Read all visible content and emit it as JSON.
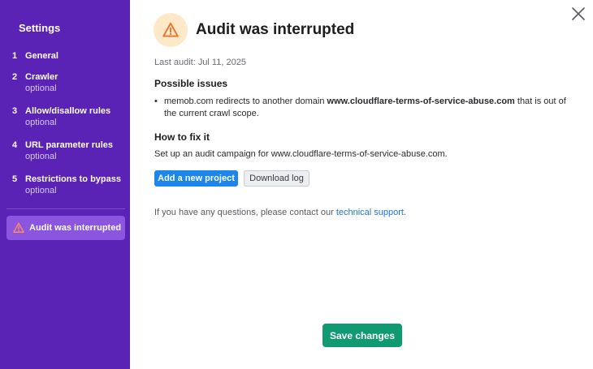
{
  "sidebar": {
    "title": "Settings",
    "steps": [
      {
        "num": "1",
        "label": "General",
        "sub": ""
      },
      {
        "num": "2",
        "label": "Crawler",
        "sub": "optional"
      },
      {
        "num": "3",
        "label": "Allow/disallow rules",
        "sub": "optional"
      },
      {
        "num": "4",
        "label": "URL parameter rules",
        "sub": "optional"
      },
      {
        "num": "5",
        "label": "Restrictions to bypass",
        "sub": "optional"
      }
    ],
    "status_label": "Audit was interrupted"
  },
  "main": {
    "title": "Audit was interrupted",
    "last_audit": "Last audit: Jul 11, 2025",
    "possible_issues_heading": "Possible issues",
    "issue": {
      "prefix": "memob.com redirects to another domain ",
      "domain": "www.cloudflare-terms-of-service-abuse.com",
      "suffix": " that is out of the current crawl scope."
    },
    "fix_heading": "How to fix it",
    "fix_text": "Set up an audit campaign for www.cloudflare-terms-of-service-abuse.com.",
    "add_project_label": "Add a new project",
    "download_log_label": "Download log",
    "contact_prefix": "If you have any questions, please contact our ",
    "contact_link": "technical support",
    "contact_suffix": ".",
    "save_label": "Save changes"
  },
  "colors": {
    "sidebar_bg": "#5a22b5",
    "status_bg": "#8c55e0",
    "primary": "#1c86ea",
    "save": "#0f9a72",
    "warning": "#e8742a"
  },
  "icons": {
    "warning": "warning-triangle-icon",
    "close": "close-icon"
  }
}
